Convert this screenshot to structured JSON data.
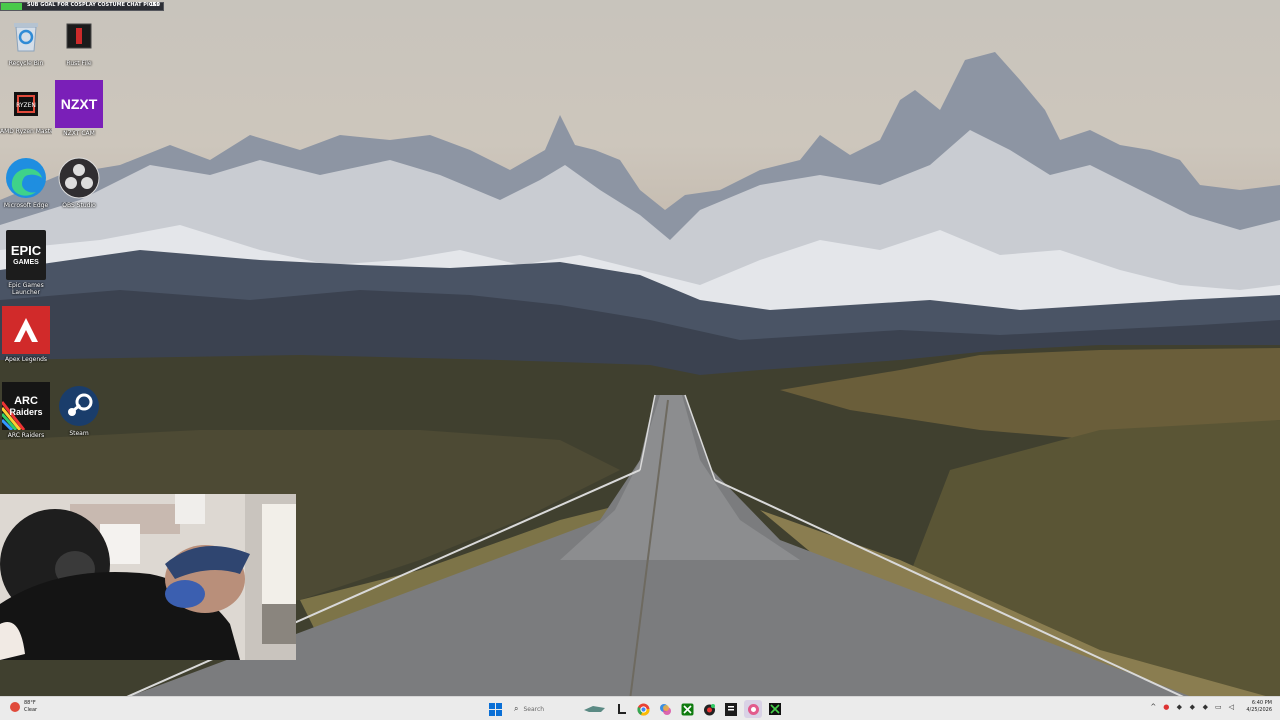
{
  "stream_overlay": {
    "goal_text": "SUB GOAL FOR COSPLAY COSTUME CHAT PICKS",
    "goal_count": "150",
    "goal_progress": 0.13,
    "goal_color": "#49c94a"
  },
  "desktop": {
    "icons": [
      {
        "label": "Recycle Bin",
        "icon": "recycle-bin-icon"
      },
      {
        "label": "Rust File",
        "icon": "rust-file-icon"
      },
      {
        "label": "AMD Ryzen Master",
        "icon": "ryzen-master-icon"
      },
      {
        "label": "NZXT CAM",
        "icon": "nzxt-cam-icon",
        "tile_text": "NZXT"
      },
      {
        "label": "Microsoft Edge",
        "icon": "edge-icon"
      },
      {
        "label": "OBS Studio",
        "icon": "obs-icon"
      },
      {
        "label": "Epic Games Launcher",
        "icon": "epic-games-icon",
        "tile_text_1": "EPIC",
        "tile_text_2": "GAMES"
      },
      {
        "label": "Apex Legends",
        "icon": "apex-legends-icon"
      },
      {
        "label": "ARC Raiders",
        "icon": "arc-raiders-icon",
        "tile_text_1": "ARC",
        "tile_text_2": "Raiders"
      },
      {
        "label": "Steam",
        "icon": "steam-icon"
      }
    ]
  },
  "taskbar": {
    "weather": {
      "temp": "88°F",
      "condition": "Clear",
      "icon": "weather-icon"
    },
    "search_placeholder": "Search",
    "apps": [
      {
        "name": "windows-start-icon"
      },
      {
        "name": "search-icon"
      },
      {
        "name": "widget-icon"
      },
      {
        "name": "file-explorer-icon"
      },
      {
        "name": "chrome-icon"
      },
      {
        "name": "copilot-icon"
      },
      {
        "name": "xbox-icon"
      },
      {
        "name": "app-icon"
      },
      {
        "name": "epic-games-icon"
      },
      {
        "name": "paint-icon"
      },
      {
        "name": "nzxt-icon"
      }
    ],
    "clock": {
      "time": "6:40 PM",
      "date": "4/25/2026"
    }
  },
  "colors": {
    "taskbar_bg": "#ebebeb",
    "accent": "#0067c0"
  }
}
